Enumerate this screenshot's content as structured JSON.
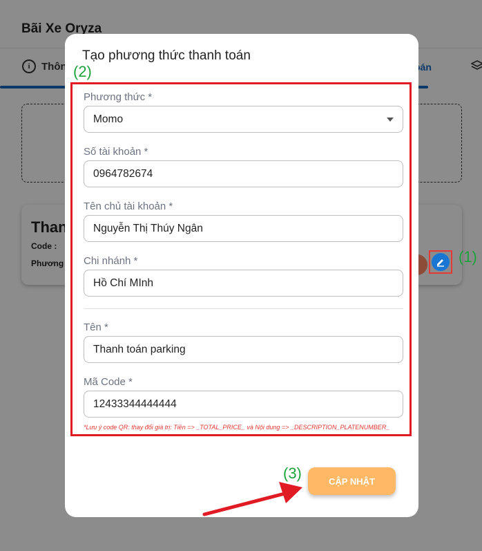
{
  "background": {
    "app_title": "Bãi Xe Oryza",
    "tab_info_label": "Thôn",
    "tab_payment_label": "oán",
    "card": {
      "title": "Than",
      "code_label": "Code :",
      "method_label": "Phương"
    }
  },
  "annotations": {
    "one": "(1)",
    "two": "(2)",
    "three": "(3)"
  },
  "modal": {
    "title": "Tạo phương thức thanh toán",
    "fields": {
      "method": {
        "label": "Phương thức *",
        "value": "Momo"
      },
      "account_number": {
        "label": "Số tài khoản *",
        "value": "0964782674"
      },
      "account_holder": {
        "label": "Tên chủ tài khoản *",
        "value": "Nguyễn Thị Thúy Ngân"
      },
      "branch": {
        "label": "Chi nhánh *",
        "value": "Hồ Chí MInh"
      },
      "name": {
        "label": "Tên *",
        "value": "Thanh toán parking"
      },
      "code": {
        "label": "Mã Code *",
        "value": "12433344444444"
      }
    },
    "note": "*Lưu ý code QR: thay đổi giá trị: Tiền => _TOTAL_PRICE_ và Nội dung => _DESCRIPTION_PLATENUMBER_",
    "submit_label": "CẬP NHẬT"
  },
  "colors": {
    "highlight_border": "#e01b24",
    "annotation_text": "#1aa33a",
    "submit_button": "#ffb866",
    "primary": "#1976d2"
  }
}
